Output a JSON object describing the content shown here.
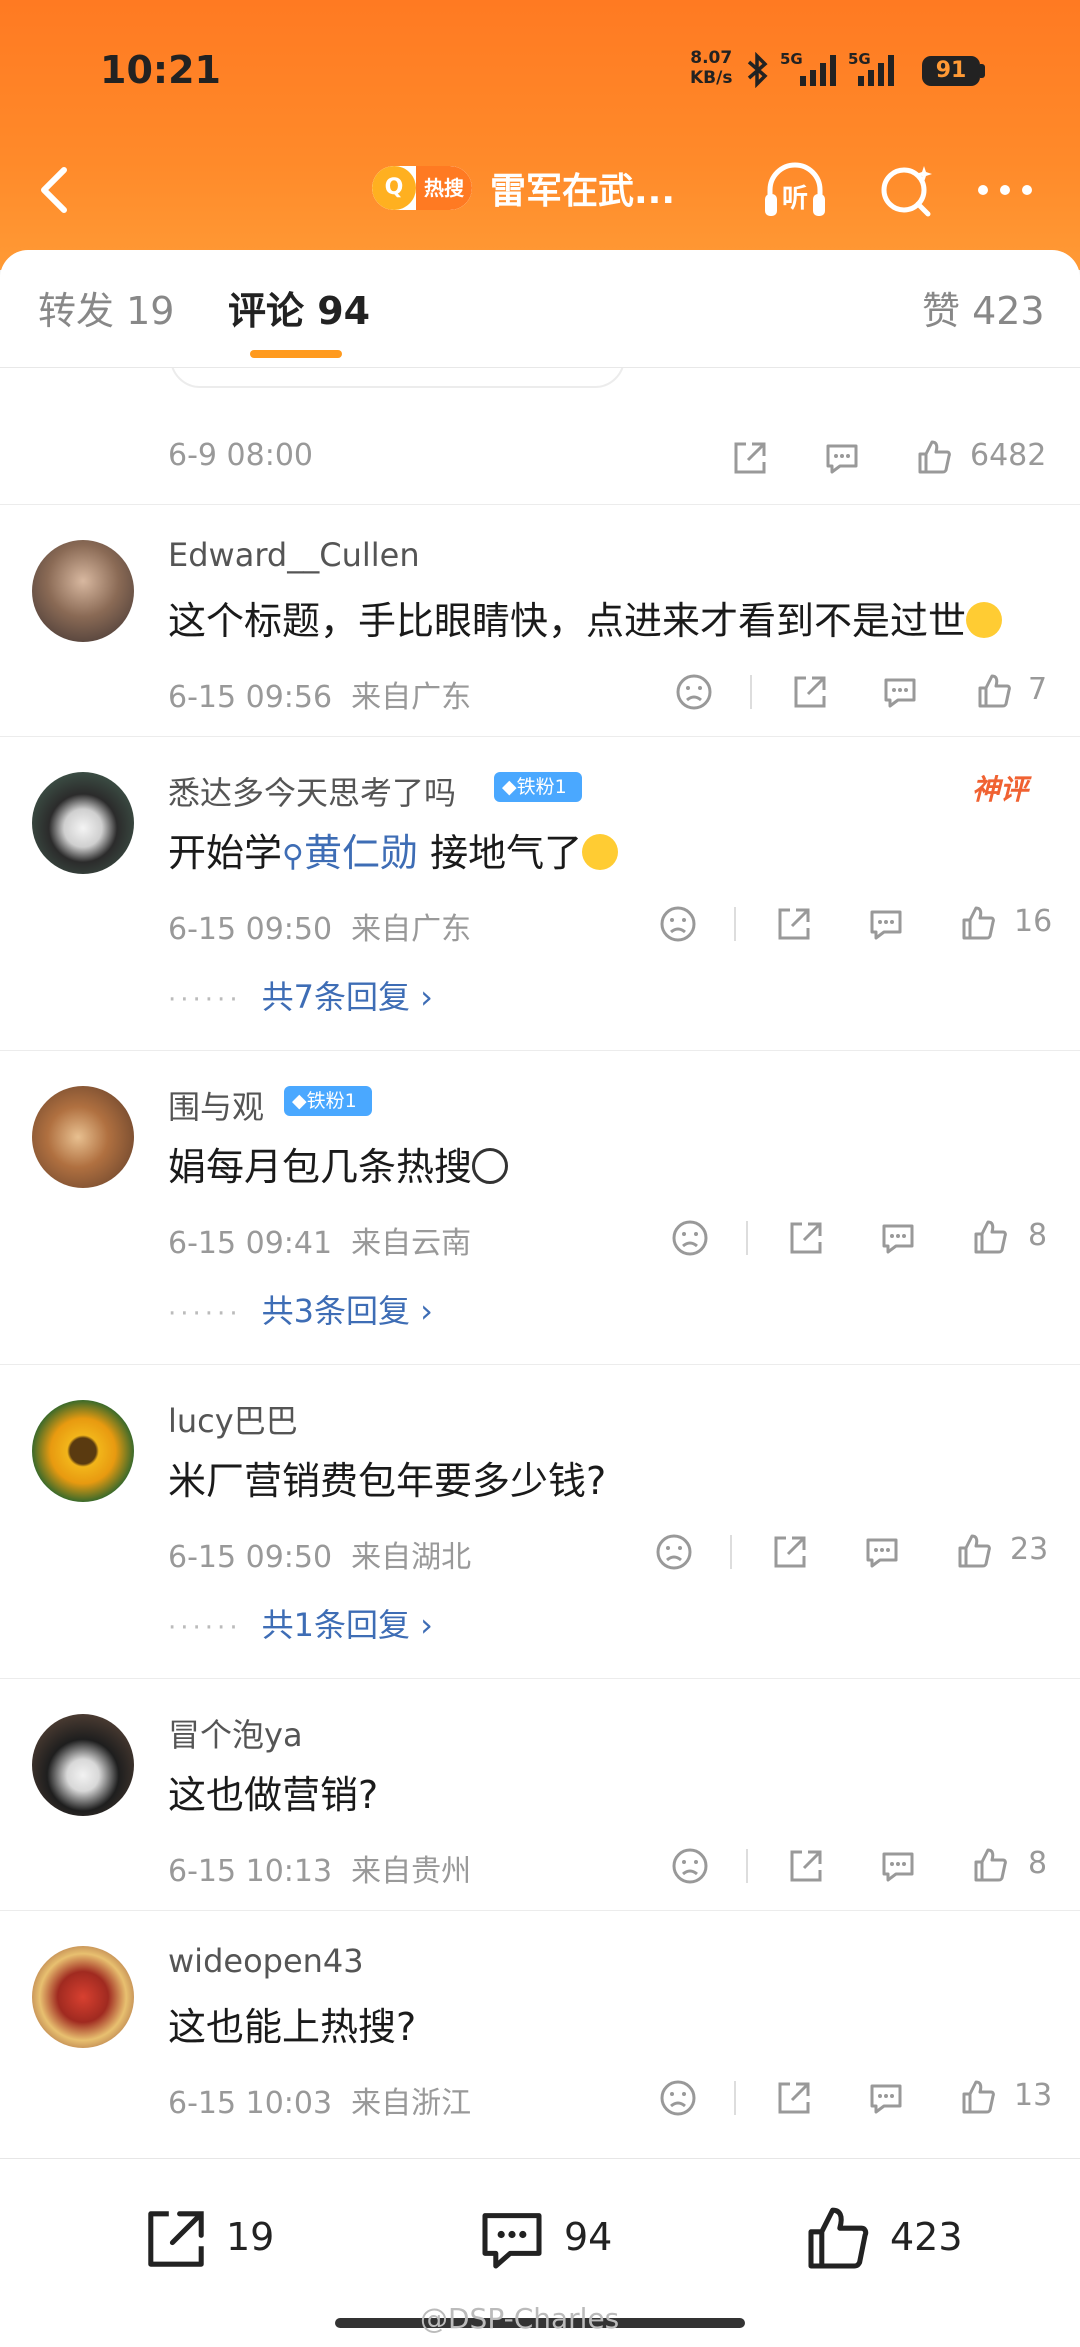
{
  "status_bar": {
    "time": "10:21",
    "net_speed_value": "8.07",
    "net_speed_unit": "KB/s",
    "signal1_label": "5G",
    "signal2_label": "5G",
    "battery": "91"
  },
  "nav": {
    "hot_badge": "热搜",
    "title": "雷军在武...",
    "listen_label": "听"
  },
  "tabs": {
    "repost": "转发 19",
    "comments": "评论 94",
    "likes": "赞 423"
  },
  "previous_post": {
    "time": "6-9 08:00",
    "like_count": "6482"
  },
  "comments": [
    {
      "username": "Edward__Cullen",
      "text": "这个标题，手比眼睛快，点进来才看到不是过世",
      "emoji": "laugh-cry-emoji",
      "time": "6-15 09:56",
      "location": "来自广东",
      "like_count": "7"
    },
    {
      "username": "悉达多今天思考了吗",
      "badge": "铁粉1",
      "text_before": "开始学",
      "link_text": "黄仁勋",
      "text_after": " 接地气了",
      "emoji": "laugh-cry-emoji",
      "tag": "神评",
      "time": "6-15 09:50",
      "location": "来自广东",
      "like_count": "16",
      "replies": "共7条回复"
    },
    {
      "username": "围与观",
      "badge": "铁粉1",
      "text": "娟每月包几条热搜",
      "emoji": "panda-emoji",
      "time": "6-15 09:41",
      "location": "来自云南",
      "like_count": "8",
      "replies": "共3条回复"
    },
    {
      "username": "lucy巴巴",
      "text": "米厂营销费包年要多少钱?",
      "time": "6-15 09:50",
      "location": "来自湖北",
      "like_count": "23",
      "replies": "共1条回复"
    },
    {
      "username": "冒个泡ya",
      "text": "这也做营销?",
      "time": "6-15 10:13",
      "location": "来自贵州",
      "like_count": "8"
    },
    {
      "username": "wideopen43",
      "text": "这也能上热搜?",
      "time": "6-15 10:03",
      "location": "来自浙江",
      "like_count": "13"
    }
  ],
  "bottom_bar": {
    "repost_count": "19",
    "comment_count": "94",
    "like_count": "423"
  },
  "watermark": "@DSP-Charles",
  "colors": {
    "header_orange": "#ff7a22",
    "link_blue": "#3e6db5",
    "fan_badge_blue": "#4aa8ff",
    "tab_underline": "#ff9a1e",
    "shenping_red": "#f06232"
  }
}
